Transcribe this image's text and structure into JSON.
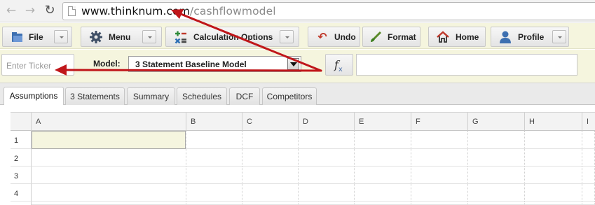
{
  "browser": {
    "back_icon": "back-arrow-icon",
    "forward_icon": "forward-arrow-icon",
    "reload_icon": "reload-icon",
    "url_domain": "www.thinknum.com",
    "url_path": "/cashflowmodel"
  },
  "toolbar": {
    "file_label": "File",
    "menu_label": "Menu",
    "calc_label": "Calculation Options",
    "undo_label": "Undo",
    "format_label": "Format",
    "home_label": "Home",
    "profile_label": "Profile"
  },
  "model_row": {
    "ticker_placeholder": "Enter Ticker",
    "model_label": "Model:",
    "model_value": "3 Statement Baseline Model",
    "formula_value": ""
  },
  "tabs": [
    {
      "label": "Assumptions",
      "active": true
    },
    {
      "label": "3 Statements",
      "active": false
    },
    {
      "label": "Summary",
      "active": false
    },
    {
      "label": "Schedules",
      "active": false
    },
    {
      "label": "DCF",
      "active": false
    },
    {
      "label": "Competitors",
      "active": false
    }
  ],
  "grid": {
    "columns": [
      "A",
      "B",
      "C",
      "D",
      "E",
      "F",
      "G",
      "H",
      "I"
    ],
    "rows": [
      "1",
      "2",
      "3",
      "4"
    ],
    "selected_cell": "A1"
  },
  "colors": {
    "toolbar_bg": "#f5f5de",
    "annotation_arrow": "#c0161a"
  }
}
